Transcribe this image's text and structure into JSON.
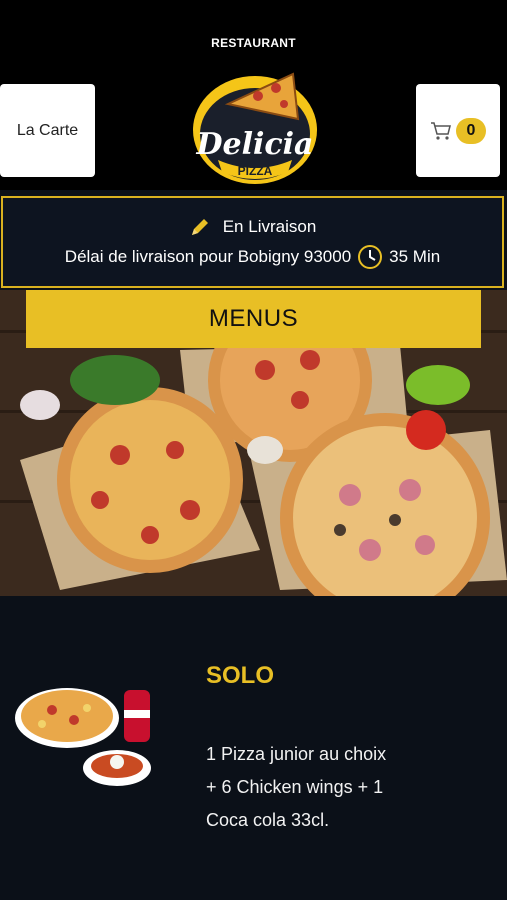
{
  "header": {
    "top_label": "RESTAURANT",
    "carte_label": "La Carte",
    "cart_count": "0",
    "logo_main": "Delicia",
    "logo_sub": "PIZZA"
  },
  "delivery": {
    "mode": "En Livraison",
    "delay_text": "Délai de livraison pour Bobigny 93000",
    "time": "35 Min"
  },
  "menu_bar": {
    "label": "MENUS"
  },
  "offer": {
    "title": "SOLO",
    "description": "1 Pizza junior au choix  + 6 Chicken wings  + 1 Coca cola 33cl."
  },
  "colors": {
    "accent": "#e8bf25",
    "header_bg": "#000000",
    "page_bg": "#0b1018"
  }
}
